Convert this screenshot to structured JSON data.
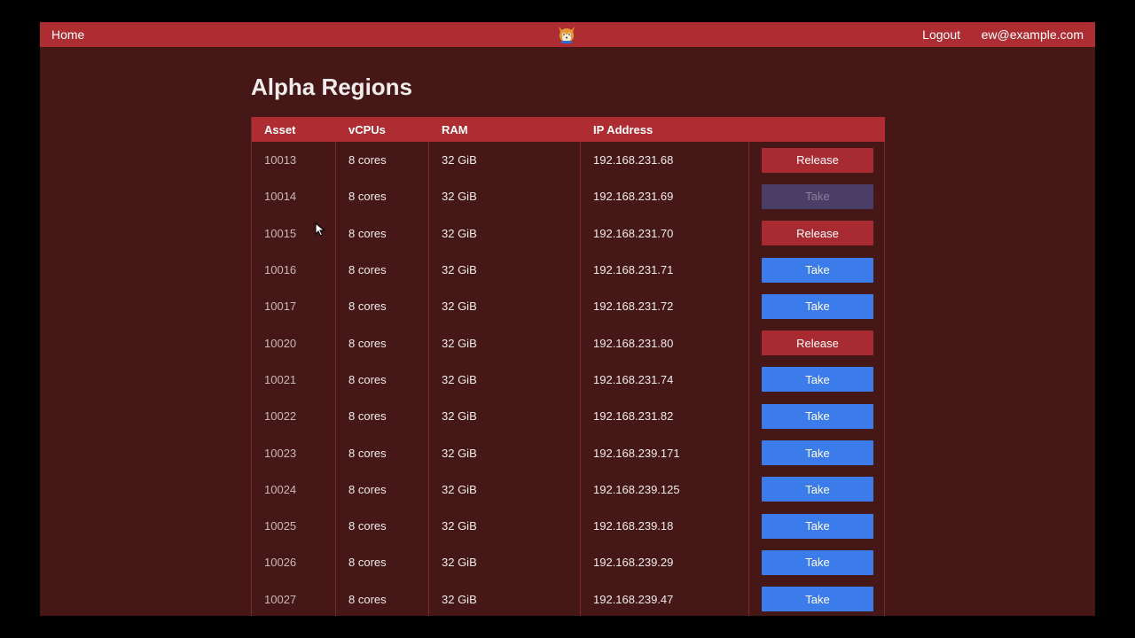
{
  "navbar": {
    "home_label": "Home",
    "logo_icon": "fox-mascot-icon",
    "logout_label": "Logout",
    "user_email": "ew@example.com"
  },
  "page": {
    "title": "Alpha Regions"
  },
  "table": {
    "columns": [
      "Asset",
      "vCPUs",
      "RAM",
      "IP Address",
      ""
    ],
    "rows": [
      {
        "asset": "10013",
        "vcpus": "8 cores",
        "ram": "32 GiB",
        "ip": "192.168.231.68",
        "action": "Release",
        "action_type": "release"
      },
      {
        "asset": "10014",
        "vcpus": "8 cores",
        "ram": "32 GiB",
        "ip": "192.168.231.69",
        "action": "Take",
        "action_type": "disabled"
      },
      {
        "asset": "10015",
        "vcpus": "8 cores",
        "ram": "32 GiB",
        "ip": "192.168.231.70",
        "action": "Release",
        "action_type": "release"
      },
      {
        "asset": "10016",
        "vcpus": "8 cores",
        "ram": "32 GiB",
        "ip": "192.168.231.71",
        "action": "Take",
        "action_type": "take"
      },
      {
        "asset": "10017",
        "vcpus": "8 cores",
        "ram": "32 GiB",
        "ip": "192.168.231.72",
        "action": "Take",
        "action_type": "take"
      },
      {
        "asset": "10020",
        "vcpus": "8 cores",
        "ram": "32 GiB",
        "ip": "192.168.231.80",
        "action": "Release",
        "action_type": "release"
      },
      {
        "asset": "10021",
        "vcpus": "8 cores",
        "ram": "32 GiB",
        "ip": "192.168.231.74",
        "action": "Take",
        "action_type": "take"
      },
      {
        "asset": "10022",
        "vcpus": "8 cores",
        "ram": "32 GiB",
        "ip": "192.168.231.82",
        "action": "Take",
        "action_type": "take"
      },
      {
        "asset": "10023",
        "vcpus": "8 cores",
        "ram": "32 GiB",
        "ip": "192.168.239.171",
        "action": "Take",
        "action_type": "take"
      },
      {
        "asset": "10024",
        "vcpus": "8 cores",
        "ram": "32 GiB",
        "ip": "192.168.239.125",
        "action": "Take",
        "action_type": "take"
      },
      {
        "asset": "10025",
        "vcpus": "8 cores",
        "ram": "32 GiB",
        "ip": "192.168.239.18",
        "action": "Take",
        "action_type": "take"
      },
      {
        "asset": "10026",
        "vcpus": "8 cores",
        "ram": "32 GiB",
        "ip": "192.168.239.29",
        "action": "Take",
        "action_type": "take"
      },
      {
        "asset": "10027",
        "vcpus": "8 cores",
        "ram": "32 GiB",
        "ip": "192.168.239.47",
        "action": "Take",
        "action_type": "take"
      }
    ]
  },
  "colors": {
    "background": "#461717",
    "navbar": "#ad2d32",
    "release_button": "#a82b31",
    "take_button": "#3c7cea",
    "disabled_button": "#4a3d66"
  }
}
